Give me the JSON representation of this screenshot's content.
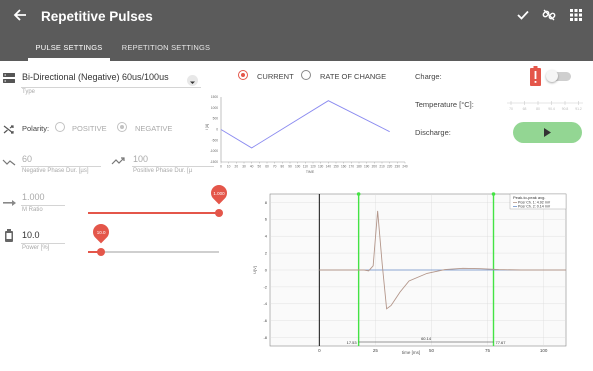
{
  "header": {
    "title": "Repetitive Pulses",
    "icons": {
      "back": "arrow-left-icon",
      "confirm": "check-icon",
      "link_off": "link-off-icon",
      "grid": "grid-icon"
    }
  },
  "tabs": [
    {
      "label": "PULSE SETTINGS",
      "active": true
    },
    {
      "label": "REPETITION SETTINGS",
      "active": false
    }
  ],
  "pulse": {
    "type_value": "Bi-Directional (Negative) 60us/100us",
    "type_caption": "Type",
    "polarity_label": "Polarity:",
    "polarity_options": [
      {
        "label": "POSITIVE",
        "selected": false
      },
      {
        "label": "NEGATIVE",
        "selected": true
      }
    ],
    "negative_phase": {
      "value": "60",
      "caption": "Negative Phase Dur. [µs]"
    },
    "positive_phase": {
      "value": "100",
      "caption": "Positive Phase Dur. [µ"
    },
    "m_ratio": {
      "value": "1.000",
      "caption": "M Ratio",
      "bubble": "1.000",
      "fraction": 1.0
    },
    "power": {
      "value": "10.0",
      "caption": "Power [%]",
      "bubble": "10.0",
      "fraction": 0.1
    }
  },
  "view_mode": {
    "options": [
      {
        "label": "CURRENT",
        "selected": true
      },
      {
        "label": "RATE OF CHANGE",
        "selected": false
      }
    ]
  },
  "waveform_chart": {
    "y_ticks": [
      "1500",
      "1000",
      "500",
      "0",
      "-500",
      "-1000",
      "-1500"
    ],
    "x_ticks": [
      "0",
      "10",
      "20",
      "30",
      "40",
      "50",
      "60",
      "70",
      "80",
      "90",
      "100",
      "110",
      "120",
      "130",
      "140",
      "150",
      "160",
      "170",
      "180",
      "190",
      "200",
      "210",
      "220",
      "230",
      "240"
    ],
    "ylabel": "I [A]",
    "xlabel": "TIME",
    "color": "#8b8bf0"
  },
  "status": {
    "charge_label": "Charge:",
    "temperature_label": "Temperature [°C]:",
    "discharge_label": "Discharge:",
    "charge_toggle_on": false,
    "temperature_ticks": [
      "70",
      "68",
      "80",
      "90.4",
      "90.8",
      "91.2"
    ],
    "colors": {
      "alert": "#e4564a",
      "play": "#93d693"
    }
  },
  "scope": {
    "legend_title": "Peak-to-peak avg.",
    "legend_items": [
      "Pos/ Ch. 1: 4.92 mV",
      "Pos/ Ch. 2: 0.14 mV"
    ],
    "y_ticks": [
      "8",
      "6",
      "4",
      "2",
      "0",
      "-2",
      "-4",
      "-6",
      "-8"
    ],
    "x_ticks": [
      "0",
      "25",
      "50",
      "75",
      "100"
    ],
    "xlabel": "time [ms]",
    "ylabel": "U[V]",
    "cursor_left_label": "17.53",
    "cursor_right_label": "77.67",
    "delta_label": "60.14"
  },
  "chart_data": [
    {
      "type": "line",
      "series": [
        {
          "x": [
            0,
            40,
            140,
            220
          ],
          "y": [
            0,
            -850,
            1330,
            -100
          ]
        }
      ],
      "xlabel": "TIME",
      "ylabel": "I [A]",
      "xlim": [
        0,
        240
      ],
      "ylim": [
        -1500,
        1500
      ],
      "grid": false
    },
    {
      "type": "line",
      "series": [
        {
          "name": "Pos/ Ch. 1: 4.92 mV",
          "x": [
            0,
            10,
            20,
            22,
            24,
            26,
            28,
            30,
            32,
            34,
            36,
            40,
            48,
            56,
            64,
            72,
            80,
            90,
            100,
            110
          ],
          "y": [
            0,
            0,
            0,
            -0.1,
            0.5,
            7.0,
            0.8,
            -4.6,
            -4.2,
            -3.4,
            -2.6,
            -1.3,
            -0.4,
            0.05,
            0.2,
            0.15,
            0.05,
            0,
            0,
            0
          ]
        },
        {
          "name": "Pos/ Ch. 2: 0.14 mV",
          "x": [
            0,
            10,
            20,
            30,
            40,
            60,
            80,
            100,
            110
          ],
          "y": [
            0,
            0,
            0,
            0,
            0,
            0,
            0,
            0,
            0
          ]
        }
      ],
      "xlabel": "time [ms]",
      "ylabel": "U[V]",
      "xlim": [
        -22,
        110
      ],
      "ylim": [
        -9,
        9
      ],
      "grid": true,
      "legend": "top-right"
    }
  ]
}
